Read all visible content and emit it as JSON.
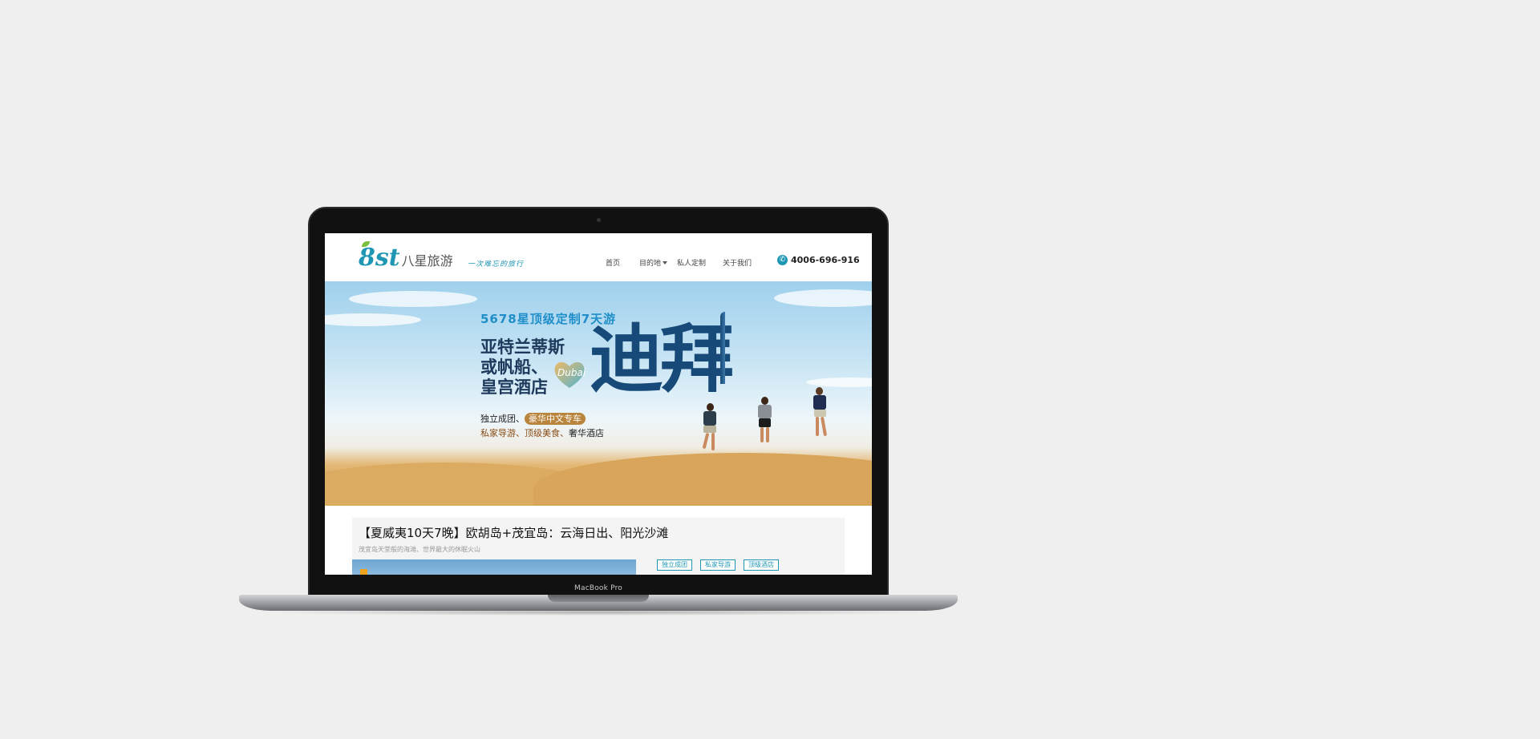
{
  "device": {
    "label": "MacBook Pro"
  },
  "site": {
    "logo_mark": "8st",
    "logo_name": "八星旅游",
    "tagline": "一次难忘的旅行",
    "nav": {
      "home": "首页",
      "destinations": "目的地",
      "custom": "私人定制",
      "about": "关于我们"
    },
    "phone": "4006-696-916"
  },
  "hero": {
    "subtitle": "5678星顶级定制7天游",
    "line_a": "亚特兰蒂斯",
    "line_b": "或帆船、",
    "line_c": "皇宫酒店",
    "big_title": "迪拜",
    "heart_label": "Dubai",
    "feature1_prefix": "独立成团、",
    "feature1_pill": "豪华中文专车",
    "feature2_a": "私家导游、",
    "feature2_b": "顶级美食、",
    "feature2_c": "奢华酒店"
  },
  "card": {
    "title": "【夏威夷10天7晚】欧胡岛+茂宜岛：云海日出、阳光沙滩",
    "subtitle": "茂宜岛天堂般的海滩、世界最大的休眠火山",
    "tags": [
      "独立成团",
      "私家导游",
      "顶级酒店"
    ]
  },
  "colors": {
    "brand": "#1f97b4",
    "hero_title": "#174a78",
    "pill": "#b9843c"
  }
}
